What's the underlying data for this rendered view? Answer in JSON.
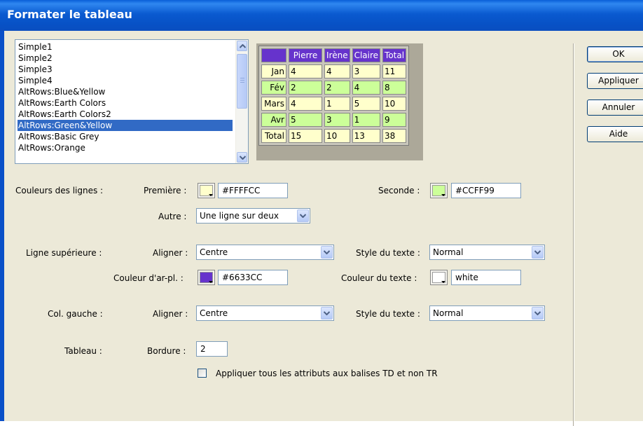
{
  "window": {
    "title": "Formater le tableau"
  },
  "style_list": {
    "items": [
      "Simple1",
      "Simple2",
      "Simple3",
      "Simple4",
      "AltRows:Blue&Yellow",
      "AltRows:Earth Colors",
      "AltRows:Earth Colors2",
      "AltRows:Green&Yellow",
      "AltRows:Basic Grey",
      "AltRows:Orange"
    ],
    "selected": "AltRows:Green&Yellow"
  },
  "preview": {
    "header": [
      "",
      "Pierre",
      "Irène",
      "Claire",
      "Total"
    ],
    "rows": [
      [
        "Jan",
        "4",
        "4",
        "3",
        "11"
      ],
      [
        "Fév",
        "2",
        "2",
        "4",
        "8"
      ],
      [
        "Mars",
        "4",
        "1",
        "5",
        "10"
      ],
      [
        "Avr",
        "5",
        "3",
        "1",
        "9"
      ],
      [
        "Total",
        "15",
        "10",
        "13",
        "38"
      ]
    ],
    "colors": {
      "header_bg": "#6633CC",
      "header_text": "#ffffff",
      "row_odd": "#FFFFCC",
      "row_even": "#CCFF99"
    }
  },
  "row_colors": {
    "section_label": "Couleurs des lignes :",
    "first_label": "Première :",
    "first_value": "#FFFFCC",
    "second_label": "Seconde :",
    "second_value": "#CCFF99",
    "other_label": "Autre :",
    "other_value": "Une ligne sur deux"
  },
  "top_row": {
    "section_label": "Ligne supérieure :",
    "align_label": "Aligner :",
    "align_value": "Centre",
    "text_style_label": "Style du texte :",
    "text_style_value": "Normal",
    "bg_label": "Couleur d'ar-pl. :",
    "bg_value": "#6633CC",
    "text_color_label": "Couleur du texte :",
    "text_color_value": "white"
  },
  "left_col": {
    "section_label": "Col. gauche :",
    "align_label": "Aligner :",
    "align_value": "Centre",
    "text_style_label": "Style du texte :",
    "text_style_value": "Normal"
  },
  "table": {
    "section_label": "Tableau :",
    "border_label": "Bordure :",
    "border_value": "2",
    "checkbox_label": "Appliquer tous les attributs aux balises TD et non TR"
  },
  "buttons": {
    "ok": "OK",
    "apply": "Appliquer",
    "cancel": "Annuler",
    "help": "Aide"
  }
}
